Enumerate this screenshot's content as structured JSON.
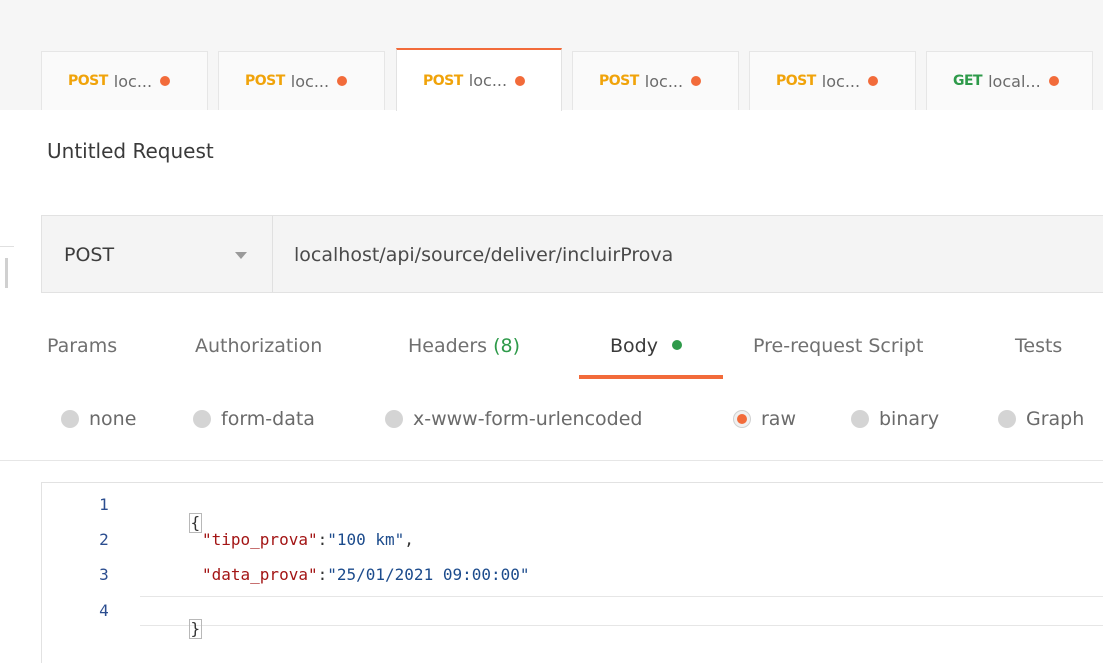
{
  "tabs": [
    {
      "method": "POST",
      "label": "loc...",
      "active": false
    },
    {
      "method": "POST",
      "label": "loc...",
      "active": false
    },
    {
      "method": "POST",
      "label": "loc...",
      "active": true
    },
    {
      "method": "POST",
      "label": "loc...",
      "active": false
    },
    {
      "method": "POST",
      "label": "loc...",
      "active": false
    },
    {
      "method": "GET",
      "label": "local...",
      "active": false
    }
  ],
  "colors": {
    "accent": "#f26b3a",
    "post": "#f0a30a",
    "get": "#2e9a4a"
  },
  "request": {
    "title": "Untitled Request",
    "method": "POST",
    "url": "localhost/api/source/deliver/incluirProva"
  },
  "subtabs": {
    "params": "Params",
    "authorization": "Authorization",
    "headers": "Headers",
    "headers_count": "(8)",
    "body": "Body",
    "prerequest": "Pre-request Script",
    "tests": "Tests"
  },
  "body_modes": {
    "none": "none",
    "form_data": "form-data",
    "urlencoded": "x-www-form-urlencoded",
    "raw": "raw",
    "binary": "binary",
    "graphql": "Graph",
    "selected": "raw"
  },
  "editor": {
    "line_numbers": [
      "1",
      "2",
      "3",
      "4"
    ],
    "line1": "{",
    "line2_key": "\"tipo_prova\"",
    "line2_colon": ":",
    "line2_value": "\"100 km\"",
    "line2_comma": ",",
    "line3_key": "\"data_prova\"",
    "line3_colon": ":",
    "line3_value": "\"25/01/2021 09:00:00\"",
    "line4": "}"
  }
}
